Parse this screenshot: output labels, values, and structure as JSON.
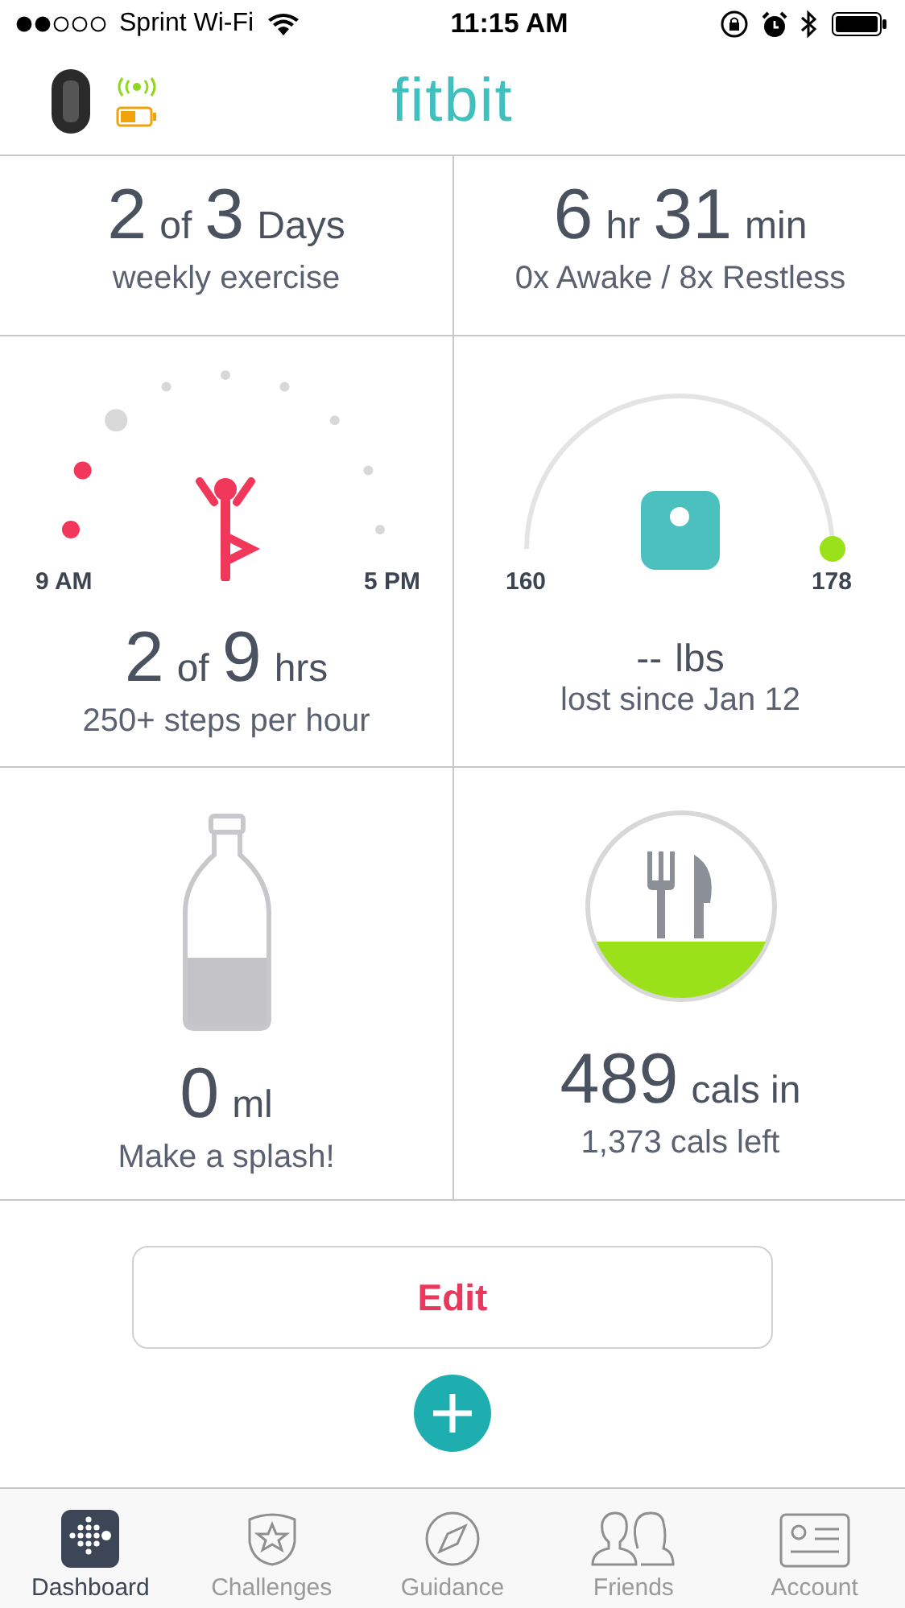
{
  "status_bar": {
    "carrier": "Sprint Wi-Fi",
    "time": "11:15 AM"
  },
  "header": {
    "logo": "fitbit"
  },
  "tiles": [
    {
      "kind": "goal",
      "value": [
        {
          "text": "2",
          "big": true
        },
        {
          "text": "of",
          "big": false
        },
        {
          "text": "3",
          "big": true
        },
        {
          "text": "Days",
          "big": false
        }
      ],
      "caption": "weekly exercise"
    },
    {
      "kind": "goal",
      "value": [
        {
          "text": "6",
          "big": true
        },
        {
          "text": "hr",
          "big": false
        },
        {
          "text": "31",
          "big": true
        },
        {
          "text": "min",
          "big": false
        }
      ],
      "caption": "0x Awake / 8x Restless"
    },
    {
      "kind": "hourly",
      "start": "9 AM",
      "end": "5 PM",
      "hours": [
        {
          "active": true,
          "current": false
        },
        {
          "active": true,
          "current": false
        },
        {
          "active": false,
          "current": true
        },
        {
          "active": false,
          "current": false
        },
        {
          "active": false,
          "current": false
        },
        {
          "active": false,
          "current": false
        },
        {
          "active": false,
          "current": false
        },
        {
          "active": false,
          "current": false
        },
        {
          "active": false,
          "current": false
        }
      ],
      "value": [
        {
          "text": "2",
          "big": true
        },
        {
          "text": "of",
          "big": false
        },
        {
          "text": "9",
          "big": true
        },
        {
          "text": "hrs",
          "big": false
        }
      ],
      "caption": "250+ steps per hour"
    },
    {
      "kind": "weight",
      "start": "160",
      "goal": "178",
      "value": [
        {
          "text": "--",
          "big": false
        },
        {
          "text": "lbs",
          "big": false
        }
      ],
      "caption": "lost since Jan 12"
    },
    {
      "kind": "water",
      "value": [
        {
          "text": "0",
          "big": true
        },
        {
          "text": "ml",
          "big": false
        }
      ],
      "caption": "Make a splash!"
    },
    {
      "kind": "food",
      "value": [
        {
          "text": "489",
          "big": true
        },
        {
          "text": "cals in",
          "big": false
        }
      ],
      "caption": "1,373 cals left"
    }
  ],
  "edit_button": "Edit",
  "tabs": [
    {
      "label": "Dashboard",
      "selected": true
    },
    {
      "label": "Challenges",
      "selected": false
    },
    {
      "label": "Guidance",
      "selected": false
    },
    {
      "label": "Friends",
      "selected": false
    },
    {
      "label": "Account",
      "selected": false
    }
  ]
}
